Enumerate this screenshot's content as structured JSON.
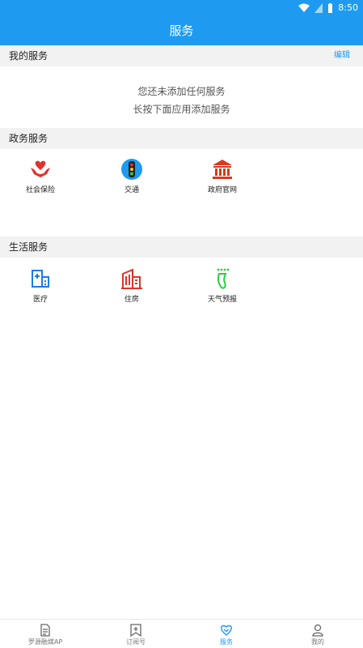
{
  "status_bar": {
    "time": "8:50"
  },
  "header": {
    "title": "服务"
  },
  "my_services": {
    "title": "我的服务",
    "edit_label": "编辑",
    "empty_line1": "您还未添加任何服务",
    "empty_line2": "长按下面应用添加服务"
  },
  "gov_services": {
    "title": "政务服务",
    "items": [
      {
        "label": "社会保险",
        "icon": "hands-heart-icon"
      },
      {
        "label": "交通",
        "icon": "traffic-light-icon"
      },
      {
        "label": "政府官网",
        "icon": "government-building-icon"
      }
    ]
  },
  "life_services": {
    "title": "生活服务",
    "items": [
      {
        "label": "医疗",
        "icon": "hospital-icon"
      },
      {
        "label": "住房",
        "icon": "building-icon"
      },
      {
        "label": "天气预报",
        "icon": "weather-icon"
      }
    ]
  },
  "tabs": [
    {
      "label": "罗源融媒AP",
      "icon": "news-icon",
      "active": false
    },
    {
      "label": "订阅号",
      "icon": "subscribe-icon",
      "active": false
    },
    {
      "label": "服务",
      "icon": "service-heart-icon",
      "active": true
    },
    {
      "label": "我的",
      "icon": "user-icon",
      "active": false
    }
  ],
  "colors": {
    "primary": "#1e9bf0",
    "section_bg": "#f2f2f2",
    "red_icon": "#e0332a",
    "green_icon": "#2ecc40"
  }
}
